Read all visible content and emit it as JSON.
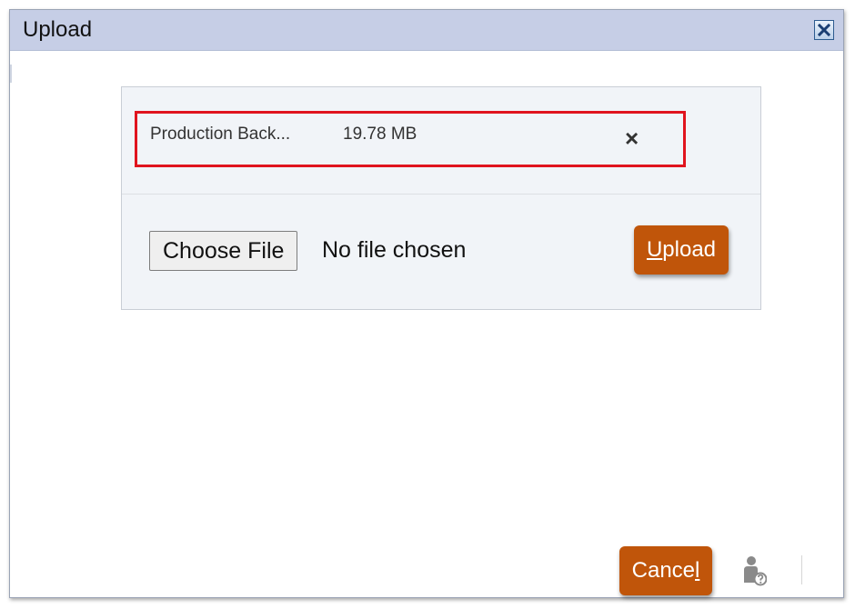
{
  "dialog": {
    "title": "Upload",
    "close_icon": "close-icon"
  },
  "file_item": {
    "name": "Production Back...",
    "size": "19.78 MB",
    "remove_label": "×"
  },
  "file_input": {
    "button_label": "Choose File",
    "status_text": "No file chosen"
  },
  "upload_button": {
    "mnemonic": "U",
    "rest": "pload"
  },
  "cancel_button": {
    "main": "Cance",
    "mnemonic": "l"
  },
  "footer": {
    "help_icon": "user-help-icon"
  },
  "colors": {
    "titlebar": "#c6cee6",
    "accent_button": "#c0550a",
    "highlight_border": "#e0141e",
    "panel_bg": "#f1f4f8"
  }
}
